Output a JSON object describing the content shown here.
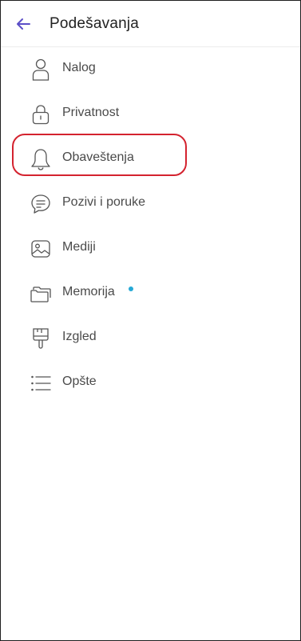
{
  "header": {
    "title": "Podešavanja",
    "back_icon": "arrow-left-icon"
  },
  "menu": {
    "items": [
      {
        "label": "Nalog",
        "icon": "person-icon"
      },
      {
        "label": "Privatnost",
        "icon": "lock-icon"
      },
      {
        "label": "Obaveštenja",
        "icon": "bell-icon"
      },
      {
        "label": "Pozivi i poruke",
        "icon": "chat-bubble-icon",
        "highlighted": true
      },
      {
        "label": "Mediji",
        "icon": "image-icon"
      },
      {
        "label": "Memorija",
        "icon": "folders-icon",
        "badge": "dot"
      },
      {
        "label": "Izgled",
        "icon": "brush-icon"
      },
      {
        "label": "Opšte",
        "icon": "list-icon"
      }
    ]
  },
  "colors": {
    "accent": "#5b4ec7",
    "highlight": "#d4232f",
    "badge": "#26a9d6",
    "icon": "#555555",
    "text": "#4a4a4a"
  }
}
